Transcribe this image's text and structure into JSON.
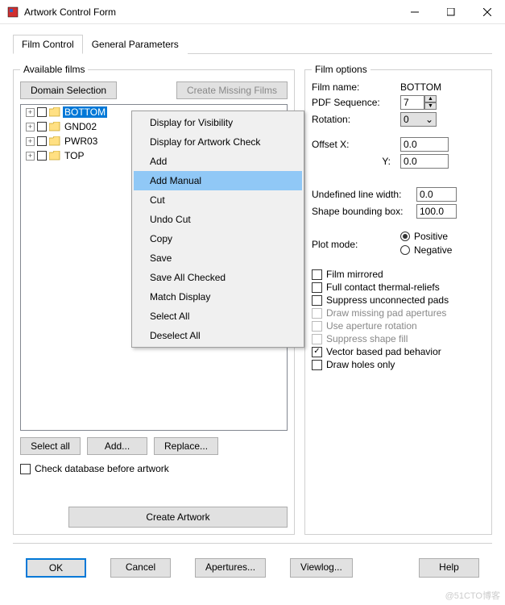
{
  "window": {
    "title": "Artwork Control Form"
  },
  "tabs": [
    {
      "label": "Film Control",
      "active": true
    },
    {
      "label": "General Parameters",
      "active": false
    }
  ],
  "films_panel": {
    "legend": "Available films",
    "domain_btn": "Domain Selection",
    "create_btn": "Create Missing Films",
    "items": [
      "BOTTOM",
      "GND02",
      "PWR03",
      "TOP"
    ],
    "selected_index": 0,
    "buttons": {
      "select_all": "Select all",
      "add": "Add...",
      "replace": "Replace..."
    },
    "check_db": "Check database before artwork",
    "create_artwork": "Create Artwork"
  },
  "context_menu": {
    "items": [
      "Display for Visibility",
      "Display for Artwork Check",
      "Add",
      "Add Manual",
      "Cut",
      "Undo Cut",
      "Copy",
      "Save",
      "Save All Checked",
      "Match Display",
      "Select All",
      "Deselect All"
    ],
    "hover_index": 3
  },
  "options_panel": {
    "legend": "Film options",
    "film_name_label": "Film name:",
    "film_name_value": "BOTTOM",
    "pdf_seq_label": "PDF Sequence:",
    "pdf_seq_value": "7",
    "rotation_label": "Rotation:",
    "rotation_value": "0",
    "offset_x_label": "Offset  X:",
    "offset_x_value": "0.0",
    "offset_y_label": "Y:",
    "offset_y_value": "0.0",
    "undef_line_label": "Undefined line width:",
    "undef_line_value": "0.0",
    "shape_box_label": "Shape bounding box:",
    "shape_box_value": "100.0",
    "plot_mode_label": "Plot mode:",
    "plot_positive": "Positive",
    "plot_negative": "Negative",
    "plot_selected": "positive",
    "checks": [
      {
        "label": "Film mirrored",
        "checked": false,
        "disabled": false
      },
      {
        "label": "Full contact thermal-reliefs",
        "checked": false,
        "disabled": false
      },
      {
        "label": "Suppress unconnected pads",
        "checked": false,
        "disabled": false
      },
      {
        "label": "Draw missing pad apertures",
        "checked": false,
        "disabled": true
      },
      {
        "label": "Use aperture rotation",
        "checked": false,
        "disabled": true
      },
      {
        "label": "Suppress shape fill",
        "checked": false,
        "disabled": true
      },
      {
        "label": "Vector based pad behavior",
        "checked": true,
        "disabled": false
      },
      {
        "label": "Draw holes only",
        "checked": false,
        "disabled": false
      }
    ]
  },
  "footer": {
    "ok": "OK",
    "cancel": "Cancel",
    "apertures": "Apertures...",
    "viewlog": "Viewlog...",
    "help": "Help"
  },
  "watermark": "@51CTO博客"
}
